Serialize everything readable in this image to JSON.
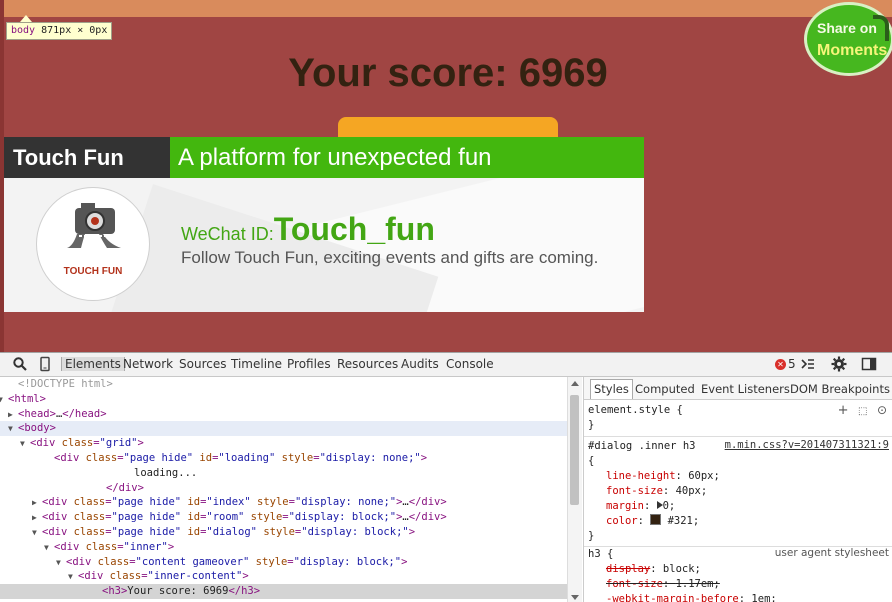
{
  "page": {
    "score_text": "Your score: 6969",
    "share": {
      "line1": "Share on",
      "line2": "Moments"
    },
    "size_tooltip": {
      "tag": "body",
      "size": "871px × 0px"
    }
  },
  "banner": {
    "brand": "Touch Fun",
    "tagline": "A platform for unexpected fun",
    "logo_text": "TOUCH FUN",
    "wechat_label": "WeChat ID:",
    "wechat_id": "Touch_fun",
    "follow_text": "Follow Touch Fun, exciting events and gifts are coming."
  },
  "devtools": {
    "tabs": [
      "Elements",
      "Network",
      "Sources",
      "Timeline",
      "Profiles",
      "Resources",
      "Audits",
      "Console"
    ],
    "selected_tab": "Elements",
    "error_count": "5",
    "dom_lines": [
      {
        "arrow": "",
        "parts": [
          [
            "doctype",
            "<!DOCTYPE html>"
          ]
        ]
      },
      {
        "arrow": "▼",
        "parts": [
          [
            "tag",
            "<html>"
          ]
        ]
      },
      {
        "arrow": "▶",
        "parts": [
          [
            "tag",
            "<head>"
          ],
          [
            "text",
            "…"
          ],
          [
            "tag",
            "</head>"
          ]
        ]
      },
      {
        "arrow": "▼",
        "parts": [
          [
            "tag",
            "<body>"
          ]
        ]
      },
      {
        "arrow": "▼",
        "parts": [
          [
            "tag",
            "<div "
          ],
          [
            "attr",
            "class"
          ],
          [
            "tag",
            "="
          ],
          [
            "val",
            "\"grid\""
          ],
          [
            "tag",
            ">"
          ]
        ]
      },
      {
        "arrow": "",
        "parts": [
          [
            "tag",
            "<div "
          ],
          [
            "attr",
            "class"
          ],
          [
            "tag",
            "="
          ],
          [
            "val",
            "\"page hide\""
          ],
          [
            "tag",
            " "
          ],
          [
            "attr",
            "id"
          ],
          [
            "tag",
            "="
          ],
          [
            "val",
            "\"loading\""
          ],
          [
            "tag",
            " "
          ],
          [
            "attr",
            "style"
          ],
          [
            "tag",
            "="
          ],
          [
            "val",
            "\"display: none;\""
          ],
          [
            "tag",
            ">"
          ]
        ]
      },
      {
        "arrow": "",
        "parts": [
          [
            "text",
            "loading..."
          ]
        ]
      },
      {
        "arrow": "",
        "parts": [
          [
            "tag",
            "</div>"
          ]
        ]
      },
      {
        "arrow": "▶",
        "parts": [
          [
            "tag",
            "<div "
          ],
          [
            "attr",
            "class"
          ],
          [
            "tag",
            "="
          ],
          [
            "val",
            "\"page hide\""
          ],
          [
            "tag",
            " "
          ],
          [
            "attr",
            "id"
          ],
          [
            "tag",
            "="
          ],
          [
            "val",
            "\"index\""
          ],
          [
            "tag",
            " "
          ],
          [
            "attr",
            "style"
          ],
          [
            "tag",
            "="
          ],
          [
            "val",
            "\"display: none;\""
          ],
          [
            "tag",
            ">"
          ],
          [
            "text",
            "…"
          ],
          [
            "tag",
            "</div>"
          ]
        ]
      },
      {
        "arrow": "▶",
        "parts": [
          [
            "tag",
            "<div "
          ],
          [
            "attr",
            "class"
          ],
          [
            "tag",
            "="
          ],
          [
            "val",
            "\"page hide\""
          ],
          [
            "tag",
            " "
          ],
          [
            "attr",
            "id"
          ],
          [
            "tag",
            "="
          ],
          [
            "val",
            "\"room\""
          ],
          [
            "tag",
            " "
          ],
          [
            "attr",
            "style"
          ],
          [
            "tag",
            "="
          ],
          [
            "val",
            "\"display: block;\""
          ],
          [
            "tag",
            ">"
          ],
          [
            "text",
            "…"
          ],
          [
            "tag",
            "</div>"
          ]
        ]
      },
      {
        "arrow": "▼",
        "parts": [
          [
            "tag",
            "<div "
          ],
          [
            "attr",
            "class"
          ],
          [
            "tag",
            "="
          ],
          [
            "val",
            "\"page hide\""
          ],
          [
            "tag",
            " "
          ],
          [
            "attr",
            "id"
          ],
          [
            "tag",
            "="
          ],
          [
            "val",
            "\"dialog\""
          ],
          [
            "tag",
            " "
          ],
          [
            "attr",
            "style"
          ],
          [
            "tag",
            "="
          ],
          [
            "val",
            "\"display: block;\""
          ],
          [
            "tag",
            ">"
          ]
        ]
      },
      {
        "arrow": "▼",
        "parts": [
          [
            "tag",
            "<div "
          ],
          [
            "attr",
            "class"
          ],
          [
            "tag",
            "="
          ],
          [
            "val",
            "\"inner\""
          ],
          [
            "tag",
            ">"
          ]
        ]
      },
      {
        "arrow": "▼",
        "parts": [
          [
            "tag",
            "<div "
          ],
          [
            "attr",
            "class"
          ],
          [
            "tag",
            "="
          ],
          [
            "val",
            "\"content gameover\""
          ],
          [
            "tag",
            " "
          ],
          [
            "attr",
            "style"
          ],
          [
            "tag",
            "="
          ],
          [
            "val",
            "\"display: block;\""
          ],
          [
            "tag",
            ">"
          ]
        ]
      },
      {
        "arrow": "▼",
        "parts": [
          [
            "tag",
            "<div "
          ],
          [
            "attr",
            "class"
          ],
          [
            "tag",
            "="
          ],
          [
            "val",
            "\"inner-content\""
          ],
          [
            "tag",
            ">"
          ]
        ]
      },
      {
        "arrow": "",
        "parts": [
          [
            "tag",
            "<h3>"
          ],
          [
            "text",
            "Your score: 6969"
          ],
          [
            "tag",
            "</h3>"
          ]
        ]
      }
    ],
    "styles": {
      "tabs": [
        "Styles",
        "Computed",
        "Event Listeners",
        "DOM Breakpoints"
      ],
      "element_style": "element.style {",
      "close_brace": "}",
      "rule1_selector": "#dialog .inner h3",
      "rule1_source": "m.min.css?v=201407311321:9",
      "open_brace": "{",
      "rule1_props": [
        {
          "name": "line-height",
          "value": "60px;"
        },
        {
          "name": "font-size",
          "value": "40px;"
        },
        {
          "name": "margin",
          "value": "0;"
        },
        {
          "name": "color",
          "value": "#321;"
        }
      ],
      "rule2_selector": "h3 {",
      "rule2_source": "user agent stylesheet",
      "rule2_props": [
        {
          "name": "display",
          "value": "block;"
        },
        {
          "name": "font-size",
          "value": "1.17em;"
        },
        {
          "name": "-webkit-margin-before",
          "value": "1em;"
        }
      ]
    }
  }
}
